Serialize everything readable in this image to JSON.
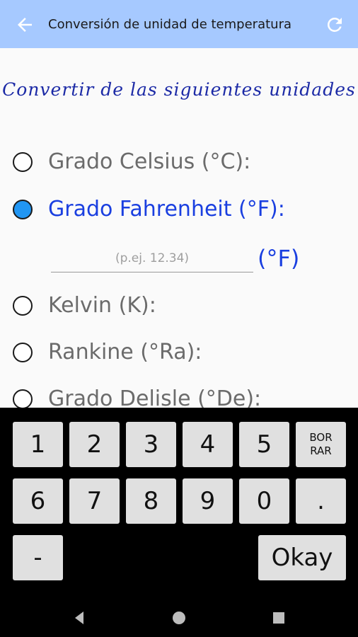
{
  "appbar": {
    "title": "Conversión de unidad de temperatura"
  },
  "heading": "Convertir de las siguientes unidades",
  "options": [
    {
      "label": "Grado Celsius (°C):",
      "selected": false
    },
    {
      "label": "Grado Fahrenheit (°F):",
      "selected": true
    },
    {
      "label": "Kelvin (K):",
      "selected": false
    },
    {
      "label": "Rankine (°Ra):",
      "selected": false
    },
    {
      "label": "Grado Delisle (°De):",
      "selected": false
    }
  ],
  "input": {
    "value": "",
    "placeholder": "(p.ej. 12.34)",
    "unit": "(°F)"
  },
  "keyboard": {
    "row1": [
      "1",
      "2",
      "3",
      "4",
      "5"
    ],
    "delete": "BOR\nRAR",
    "row2": [
      "6",
      "7",
      "8",
      "9",
      "0",
      "."
    ],
    "minus": "-",
    "okay": "Okay"
  },
  "colors": {
    "appbar": "#a6c9ff",
    "accent": "#1a3fe0",
    "radio_checked": "#2196f3",
    "heading": "#1c2aa6"
  },
  "icons": {
    "back": "arrow-left-icon",
    "refresh": "refresh-icon",
    "nav_back": "triangle-back-icon",
    "nav_home": "circle-home-icon",
    "nav_recents": "square-recents-icon"
  }
}
